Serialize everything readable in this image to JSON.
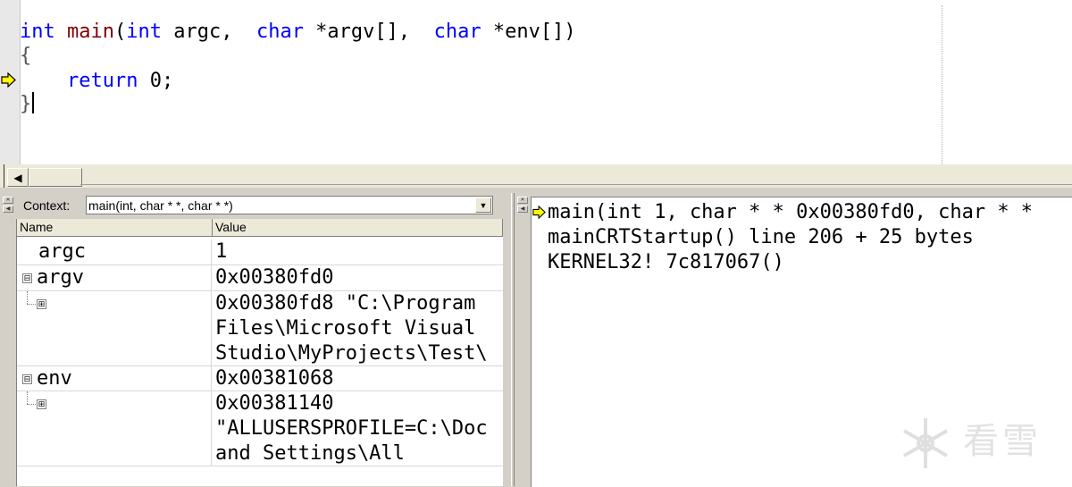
{
  "editor": {
    "lines": [
      [
        [
          "kw",
          "int"
        ],
        [
          "plain",
          " "
        ],
        [
          "fn",
          "main"
        ],
        [
          "plain",
          "("
        ],
        [
          "kw",
          "int"
        ],
        [
          "plain",
          " argc,  "
        ],
        [
          "kw",
          "char"
        ],
        [
          "plain",
          " *argv[],  "
        ],
        [
          "kw",
          "char"
        ],
        [
          "plain",
          " *env[])"
        ]
      ],
      [
        [
          "punc",
          "{"
        ]
      ],
      [
        [
          "plain",
          "    "
        ],
        [
          "kw",
          "return"
        ],
        [
          "plain",
          " 0;"
        ]
      ],
      [
        [
          "punc",
          "}"
        ]
      ]
    ],
    "current_line_icon": "yellow-arrow-icon"
  },
  "variables": {
    "context_label": "Context:",
    "context_value": "main(int, char * *, char * *)",
    "columns": [
      "Name",
      "Value"
    ],
    "rows": [
      {
        "name": "argc",
        "value": "1",
        "control": ""
      },
      {
        "name": "argv",
        "value": "0x00380fd0",
        "control": "⊟"
      },
      {
        "name": "",
        "value": "0x00380fd8 \"C:\\Program\nFiles\\Microsoft Visual\nStudio\\MyProjects\\Test\\",
        "control": "⊞"
      },
      {
        "name": "env",
        "value": "0x00381068",
        "control": "⊟"
      },
      {
        "name": "",
        "value": "0x00381140\n\"ALLUSERSPROFILE=C:\\Doc\nand Settings\\All",
        "control": "⊞"
      }
    ]
  },
  "callstack": {
    "frames": [
      "main(int 1, char * * 0x00380fd0, char * *",
      "mainCRTStartup() line 206 + 25 bytes",
      "KERNEL32! 7c817067()"
    ],
    "current_frame_icon": "yellow-arrow-icon"
  },
  "watermark": {
    "text": "看雪",
    "icon": "snowflake-icon"
  },
  "colors": {
    "keyword": "#0000ff",
    "function": "#800000",
    "arrow": "#ffff00"
  }
}
